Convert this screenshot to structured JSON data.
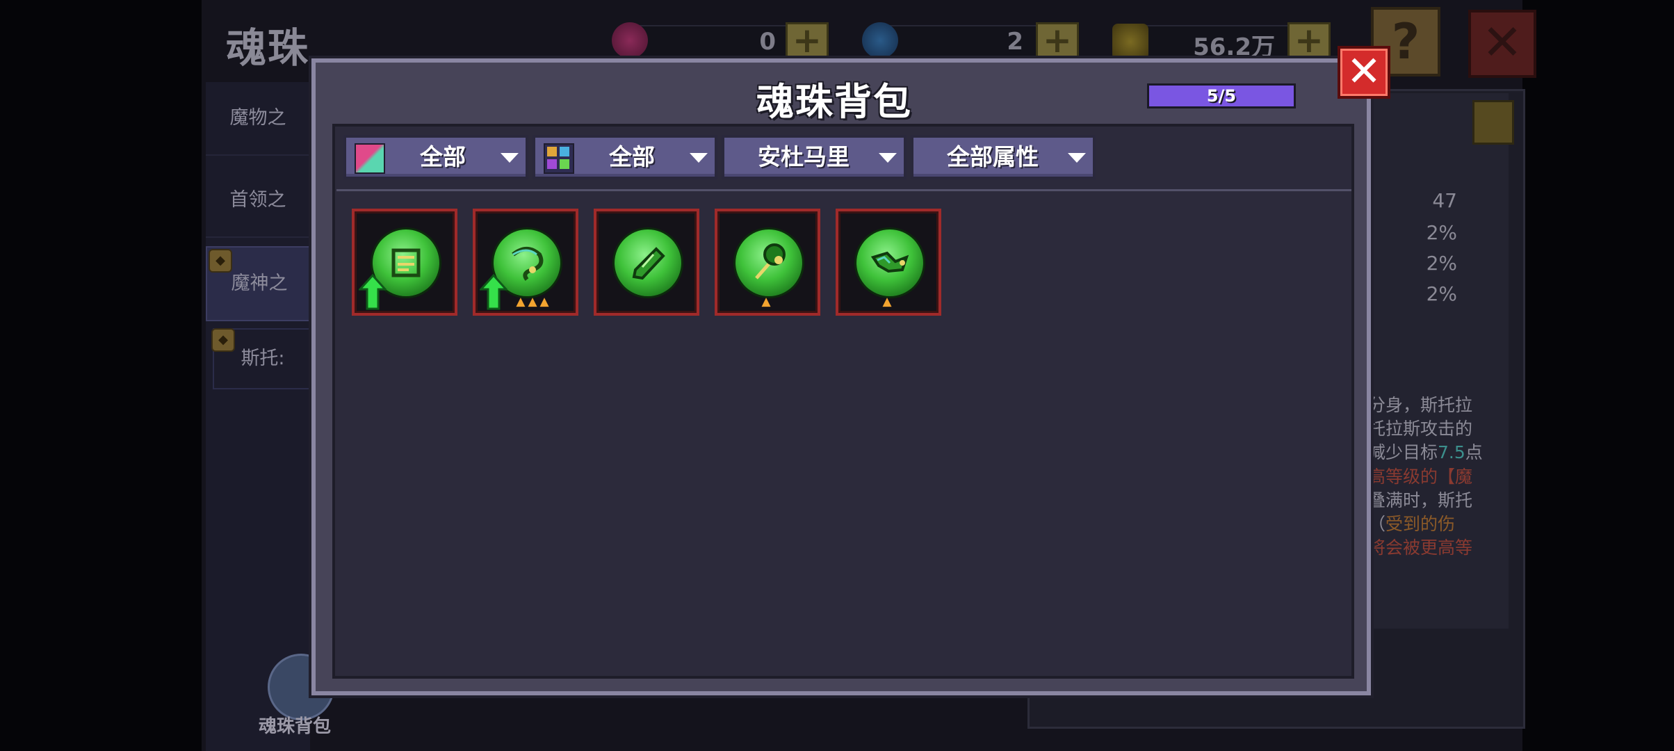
{
  "background": {
    "page_title": "魂珠",
    "sidebar_tabs": [
      "魔物之",
      "首领之",
      "魔神之",
      "斯托:"
    ],
    "bag_button_label": "魂珠背包",
    "currencies": [
      {
        "icon": "red-gem-icon",
        "value": "0"
      },
      {
        "icon": "blue-gem-icon",
        "value": "2"
      },
      {
        "icon": "gold-coin-icon",
        "value": "56.2万"
      }
    ],
    "help_symbol": "?",
    "close_symbol": "✕",
    "stats": [
      "47",
      "2%",
      "2%",
      "2%"
    ],
    "description_lines": [
      "分身，斯托拉",
      "托拉斯攻击的",
      "减少目标",
      "7.5",
      "点",
      "高等级的【魔",
      "叠满时，斯托",
      "（",
      "受到的伤",
      "将会被更高等"
    ]
  },
  "modal": {
    "title": "魂珠背包",
    "capacity_text": "5/5",
    "capacity_fraction": 1.0,
    "close_symbol": "✕",
    "filters": [
      {
        "label": "全部",
        "icon": "rarity-color-icon"
      },
      {
        "label": "全部",
        "icon": "type-grid-icon"
      },
      {
        "label": "安杜马里",
        "icon": ""
      },
      {
        "label": "全部属性",
        "icon": ""
      }
    ],
    "items": [
      {
        "icon": "green-soul-orb-scroll-icon",
        "upgrade_available": true,
        "stars": ""
      },
      {
        "icon": "green-soul-orb-serpent-icon",
        "upgrade_available": true,
        "stars": "▲▲▲"
      },
      {
        "icon": "green-soul-orb-crystal-icon",
        "upgrade_available": false,
        "stars": ""
      },
      {
        "icon": "green-soul-orb-staff-icon",
        "upgrade_available": false,
        "stars": "▲"
      },
      {
        "icon": "green-soul-orb-dragon-icon",
        "upgrade_available": false,
        "stars": "▲"
      }
    ]
  },
  "colors": {
    "accent_purple": "#7a56e2",
    "slot_border": "#a02a2a",
    "orb_green": "#3fc23a",
    "upgrade_green": "#35e04a",
    "star_orange": "#f2a430",
    "close_red": "#d42b2b"
  }
}
